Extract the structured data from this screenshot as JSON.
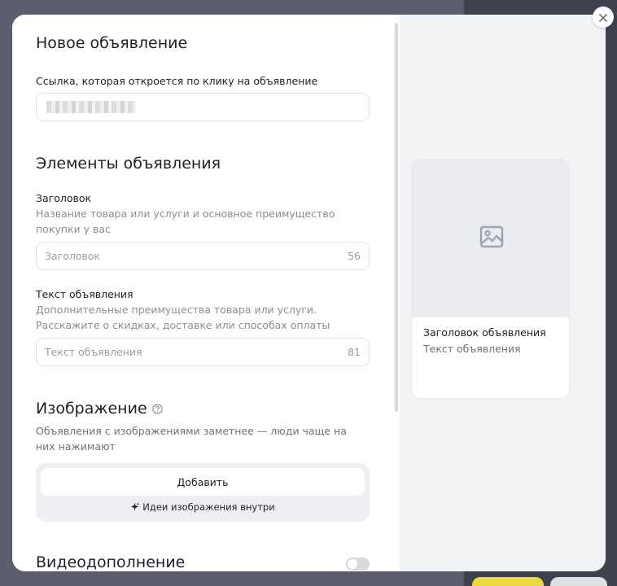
{
  "modal": {
    "title": "Новое объявление",
    "link_label": "Ссылка, которая откроется по клику на объявление",
    "link_value": "",
    "elements_heading": "Элементы объявления",
    "headline": {
      "label": "Заголовок",
      "hint": "Название товара или услуги и основное преимущество покупки у вас",
      "placeholder": "Заголовок",
      "counter": "56"
    },
    "body_text": {
      "label": "Текст объявления",
      "hint": "Дополнительные преимущества товара или услуги. Расскажите о скидках, доставке или способах оплаты",
      "placeholder": "Текст объявления",
      "counter": "81"
    },
    "image_section": {
      "heading": "Изображение",
      "hint": "Объявления с изображениями заметнее — люди чаще на них нажимают",
      "add_label": "Добавить",
      "ideas_label": "Идеи изображения внутри"
    },
    "video_section": {
      "heading": "Видеодополнение",
      "enabled": false
    }
  },
  "preview": {
    "title": "Заголовок объявления",
    "text": "Текст объявления"
  },
  "colors": {
    "accent_yellow": "#e9d83e",
    "overlay": "#5a5d6b",
    "panel_gray": "#f2f3f5"
  },
  "icons": {
    "close": "close-icon",
    "help": "question-circle-icon",
    "sparkle": "sparkle-icon",
    "image_placeholder": "image-icon"
  }
}
